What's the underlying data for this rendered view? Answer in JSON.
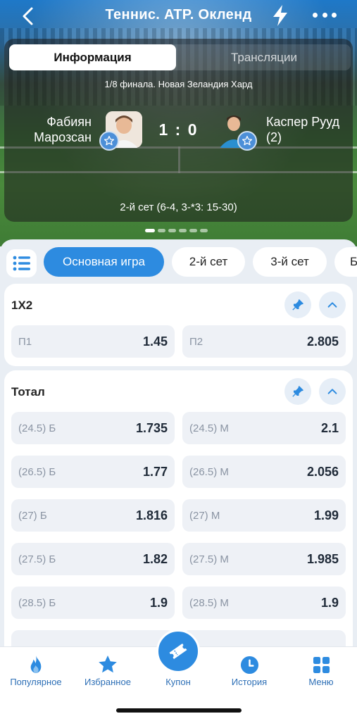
{
  "header": {
    "title": "Теннис. ATP. Окленд",
    "segments": [
      "Информация",
      "Трансляции"
    ],
    "tournament_info": "1/8 финала. Новая Зеландия Хард"
  },
  "match": {
    "player1_line1": "Фабиян",
    "player1_line2": "Марозсан",
    "player2_line1": "Каспер Рууд",
    "player2_line2": "(2)",
    "score": "1 : 0",
    "set_info": "2-й сет (6-4, 3-*3: 15-30)"
  },
  "tabs": [
    "Основная игра",
    "2-й сет",
    "3-й сет",
    "Б"
  ],
  "markets": {
    "x12": {
      "title": "1X2",
      "odds": [
        {
          "label": "П1",
          "value": "1.45"
        },
        {
          "label": "П2",
          "value": "2.805"
        }
      ]
    },
    "total": {
      "title": "Тотал",
      "rows": [
        {
          "over_label": "(24.5) Б",
          "over_value": "1.735",
          "under_label": "(24.5) М",
          "under_value": "2.1"
        },
        {
          "over_label": "(26.5) Б",
          "over_value": "1.77",
          "under_label": "(26.5) М",
          "under_value": "2.056"
        },
        {
          "over_label": "(27) Б",
          "over_value": "1.816",
          "under_label": "(27) М",
          "under_value": "1.99"
        },
        {
          "over_label": "(27.5) Б",
          "over_value": "1.82",
          "under_label": "(27.5) М",
          "under_value": "1.985"
        },
        {
          "over_label": "(28.5) Б",
          "over_value": "1.9",
          "under_label": "(28.5) М",
          "under_value": "1.9"
        }
      ]
    }
  },
  "nav": {
    "popular": "Популярное",
    "favorites": "Избранное",
    "coupon": "Купон",
    "history": "История",
    "menu": "Меню"
  },
  "colors": {
    "accent": "#2d8be0",
    "nav_text": "#2d6fb6"
  }
}
